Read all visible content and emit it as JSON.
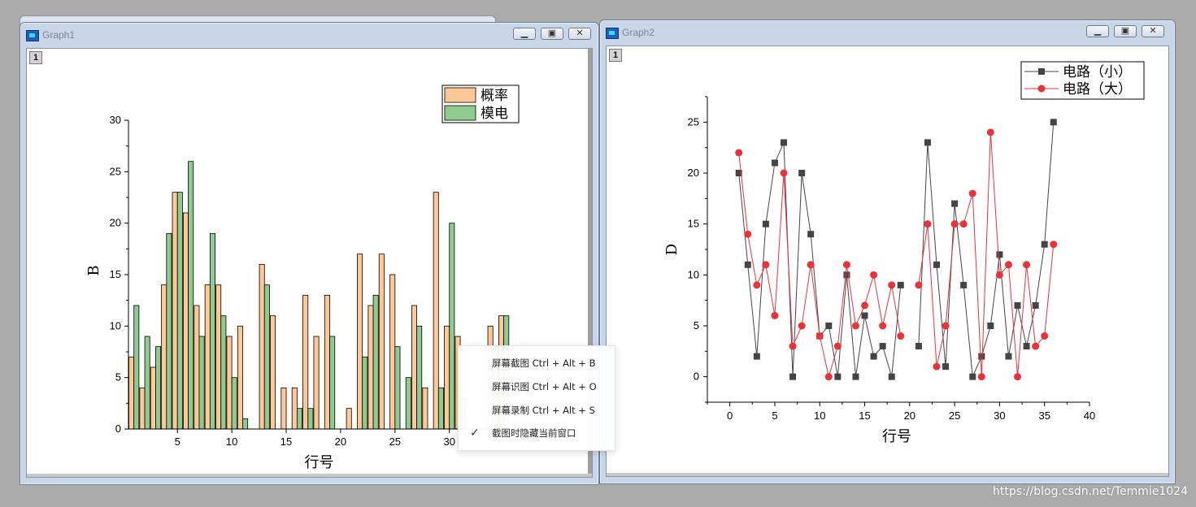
{
  "graph1": {
    "title": "Graph1",
    "layer_label": "1",
    "colors": {
      "prob": "#ffc896",
      "modian": "#8fcb8f"
    },
    "chart_data": {
      "type": "bar",
      "xlabel": "行号",
      "ylabel": "B",
      "ylim": [
        0,
        30
      ],
      "xlim": [
        0.5,
        36
      ],
      "xticks": [
        "5",
        "10",
        "15",
        "20",
        "25",
        "30"
      ],
      "yticks": [
        "0",
        "5",
        "10",
        "15",
        "20",
        "25",
        "30"
      ],
      "legend_position": "top-right",
      "x": [
        1,
        2,
        3,
        4,
        5,
        6,
        7,
        8,
        9,
        10,
        11,
        12,
        13,
        14,
        15,
        16,
        17,
        18,
        19,
        20,
        21,
        22,
        23,
        24,
        25,
        26,
        27,
        28,
        29,
        30,
        31,
        32,
        33,
        34,
        35
      ],
      "series": [
        {
          "name": "概率",
          "values": [
            7,
            4,
            6,
            14,
            23,
            21,
            12,
            14,
            14,
            9,
            10,
            null,
            16,
            11,
            4,
            4,
            13,
            9,
            13,
            null,
            2,
            17,
            12,
            17,
            15,
            null,
            12,
            4,
            23,
            10,
            9,
            null,
            null,
            10,
            11
          ]
        },
        {
          "name": "模电",
          "values": [
            12,
            9,
            8,
            19,
            23,
            26,
            9,
            19,
            11,
            5,
            1,
            null,
            14,
            null,
            null,
            2,
            2,
            null,
            9,
            null,
            null,
            7,
            13,
            null,
            8,
            5,
            10,
            null,
            4,
            20,
            3,
            null,
            null,
            8,
            11
          ]
        }
      ]
    }
  },
  "graph2": {
    "title": "Graph2",
    "layer_label": "1",
    "colors": {
      "small": "#444444",
      "large": "#e8333a"
    },
    "chart_data": {
      "type": "line",
      "xlabel": "行号",
      "ylabel": "D",
      "ylim": [
        -2.5,
        27.5
      ],
      "xlim": [
        -2.5,
        40
      ],
      "xticks": [
        "0",
        "5",
        "10",
        "15",
        "20",
        "25",
        "30",
        "35",
        "40"
      ],
      "yticks": [
        "0",
        "5",
        "10",
        "15",
        "20",
        "25"
      ],
      "legend_position": "top-right",
      "x": [
        1,
        2,
        3,
        4,
        5,
        6,
        7,
        8,
        9,
        10,
        11,
        12,
        13,
        14,
        15,
        16,
        17,
        18,
        19,
        20,
        21,
        22,
        23,
        24,
        25,
        26,
        27,
        28,
        29,
        30,
        31,
        32,
        33,
        34,
        35,
        36
      ],
      "series": [
        {
          "name": "电路（小）",
          "values": [
            20,
            11,
            2,
            15,
            21,
            23,
            0,
            20,
            14,
            4,
            5,
            0,
            10,
            0,
            6,
            2,
            3,
            0,
            9,
            null,
            3,
            23,
            11,
            1,
            17,
            9,
            0,
            2,
            5,
            12,
            2,
            7,
            3,
            7,
            13,
            25
          ]
        },
        {
          "name": "电路（大）",
          "values": [
            22,
            14,
            9,
            11,
            6,
            20,
            3,
            5,
            11,
            4,
            0,
            3,
            11,
            5,
            7,
            10,
            5,
            9,
            4,
            null,
            9,
            15,
            1,
            5,
            15,
            15,
            18,
            0,
            24,
            10,
            11,
            0,
            11,
            3,
            4,
            13
          ]
        }
      ]
    }
  },
  "context_menu": {
    "items": [
      {
        "label": "屏幕截图 Ctrl + Alt + B",
        "checked": false
      },
      {
        "label": "屏幕识图 Ctrl + Alt + O",
        "checked": false
      },
      {
        "label": "屏幕录制 Ctrl + Alt + S",
        "checked": false
      },
      {
        "label": "截图时隐藏当前窗口",
        "checked": true
      }
    ]
  },
  "watermark": "https://blog.csdn.net/Temmie1024"
}
